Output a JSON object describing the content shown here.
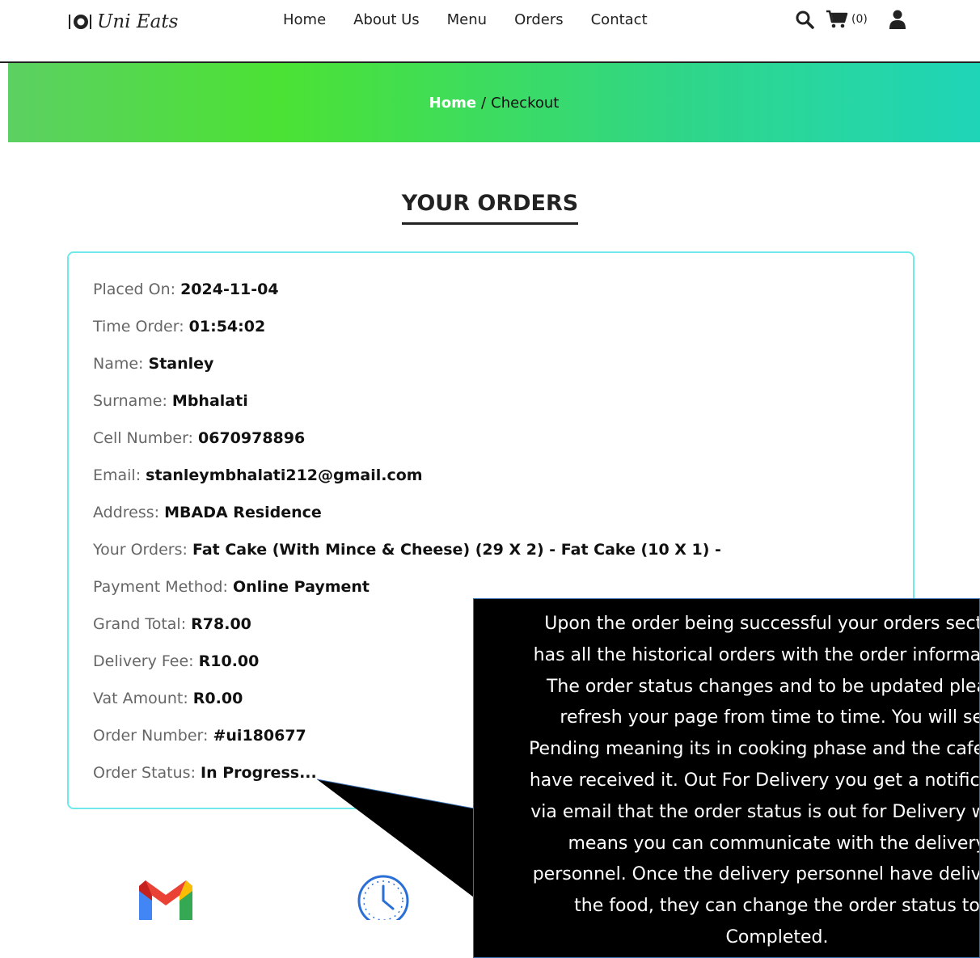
{
  "header": {
    "brand": "Uni Eats",
    "nav": [
      {
        "label": "Home"
      },
      {
        "label": "About Us"
      },
      {
        "label": "Menu"
      },
      {
        "label": "Orders"
      },
      {
        "label": "Contact"
      }
    ],
    "cart_count": "(0)"
  },
  "breadcrumb": {
    "home": "Home",
    "separator": "/",
    "current": "Checkout"
  },
  "section_title": "YOUR ORDERS",
  "order": {
    "placed_on": {
      "label": "Placed On:",
      "value": "2024-11-04"
    },
    "time_order": {
      "label": "Time Order:",
      "value": "01:54:02"
    },
    "name": {
      "label": "Name:",
      "value": "Stanley"
    },
    "surname": {
      "label": "Surname:",
      "value": "Mbhalati"
    },
    "cell": {
      "label": "Cell Number:",
      "value": "0670978896"
    },
    "email": {
      "label": "Email:",
      "value": "stanleymbhalati212@gmail.com"
    },
    "address": {
      "label": "Address:",
      "value": "MBADA Residence"
    },
    "items": {
      "label": "Your Orders:",
      "value": "Fat Cake (With Mince & Cheese) (29 X 2) - Fat Cake (10 X 1) -"
    },
    "payment": {
      "label": "Payment Method:",
      "value": "Online Payment"
    },
    "grand_total": {
      "label": "Grand Total:",
      "value": "R78.00"
    },
    "delivery_fee": {
      "label": "Delivery Fee:",
      "value": "R10.00"
    },
    "vat": {
      "label": "Vat Amount:",
      "value": "R0.00"
    },
    "order_number": {
      "label": "Order Number:",
      "value": "#ui180677"
    },
    "status": {
      "label": "Order Status:",
      "value": "In Progress..."
    }
  },
  "callout": {
    "text": "Upon the order being successful your orders section\nhas all the historical orders with the order information.\nThe order status changes and to be updated please\nrefresh your page from time to time. You will see\nPending meaning its in cooking phase and the cafeteria\nhave received it. Out For Delivery you get a notification\nvia email that the order status is out for Delivery which\nmeans you can communicate with the delivery\npersonnel. Once the delivery personnel have delivered\nthe food, they can change the order status to\nCompleted."
  },
  "colors": {
    "banner_start": "#5cd062",
    "banner_end": "#1fd5b8",
    "card_border": "#6fe9e9",
    "gmail_red": "#ea4335",
    "clock_blue": "#2a6fd6"
  }
}
